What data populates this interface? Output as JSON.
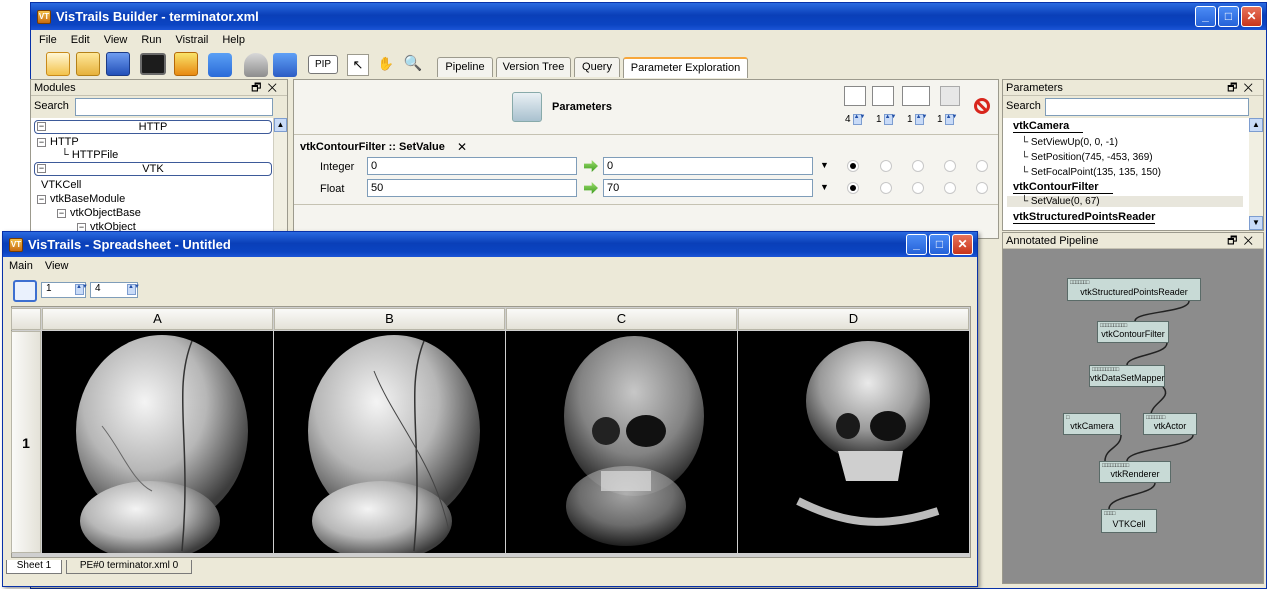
{
  "builder": {
    "title": "VisTrails Builder - terminator.xml",
    "menu": [
      "File",
      "Edit",
      "View",
      "Run",
      "Vistrail",
      "Help"
    ],
    "pip_label": "PIP",
    "tabs": [
      "Pipeline",
      "Version Tree",
      "Query",
      "Parameter Exploration"
    ],
    "active_tab": "Parameter Exploration"
  },
  "modules_panel": {
    "title": "Modules",
    "search_label": "Search",
    "sections": [
      "HTTP",
      "VTK"
    ],
    "items": [
      "HTTP",
      "HTTPFile",
      "VTKCell",
      "vtkBaseModule",
      "vtkObjectBase",
      "vtkObject"
    ]
  },
  "parameter_exploration": {
    "header": "Parameters",
    "spinners": [
      "4",
      "1",
      "1",
      "1"
    ],
    "function_label": "vtkContourFilter :: SetValue",
    "rows": [
      {
        "label": "Integer",
        "start": "0",
        "end": "0"
      },
      {
        "label": "Float",
        "start": "50",
        "end": "70"
      }
    ]
  },
  "parameters_panel": {
    "title": "Parameters",
    "search_label": "Search",
    "groups": [
      {
        "name": "vtkCamera",
        "items": [
          "SetViewUp(0, 0, -1)",
          "SetPosition(745, -453, 369)",
          "SetFocalPoint(135, 135, 150)"
        ]
      },
      {
        "name": "vtkContourFilter",
        "items": [
          "SetValue(0, 67)"
        ]
      },
      {
        "name": "vtkStructuredPointsReader",
        "items": []
      }
    ]
  },
  "annotated_pipeline": {
    "title": "Annotated Pipeline",
    "nodes": [
      "vtkStructuredPointsReader",
      "vtkContourFilter",
      "vtkDataSetMapper",
      "vtkCamera",
      "vtkActor",
      "vtkRenderer",
      "VTKCell"
    ]
  },
  "spreadsheet": {
    "title": "VisTrails - Spreadsheet - Untitled",
    "menu": [
      "Main",
      "View"
    ],
    "rows_value": "1",
    "cols_value": "4",
    "columns": [
      "A",
      "B",
      "C",
      "D"
    ],
    "row_labels": [
      "1"
    ],
    "sheet_tabs": [
      "Sheet 1",
      "PE#0 terminator.xml 0"
    ]
  },
  "colors": {
    "titlebar": "#0b44c2",
    "chrome": "#ece9d8",
    "canvas": "#8c8c8c",
    "node": "#c8dad6",
    "active_tab_accent": "#f7a73b"
  }
}
